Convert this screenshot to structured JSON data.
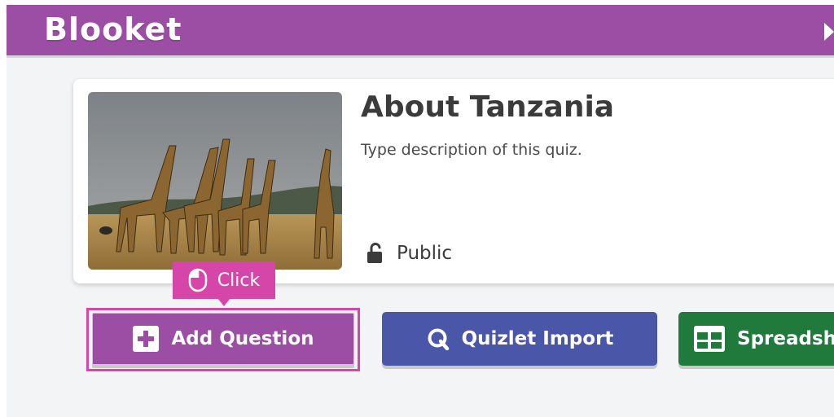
{
  "header": {
    "logo_text": "Blooket",
    "brand_color": "#9b4ea3"
  },
  "quiz": {
    "title": "About Tanzania",
    "description": "Type description of this quiz.",
    "visibility_label": "Public",
    "cover_image": "giraffes-on-savanna-photo"
  },
  "tooltip": {
    "label": "Click",
    "icon": "mouse-icon",
    "color": "#d645a8"
  },
  "actions": {
    "add_question": {
      "label": "Add Question",
      "icon": "plus-square-icon",
      "color": "#9b4ea3"
    },
    "quizlet_import": {
      "label": "Quizlet Import",
      "icon": "quizlet-q-icon",
      "color": "#4a56a8"
    },
    "spreadsheet": {
      "label": "Spreadsheet",
      "icon": "spreadsheet-grid-icon",
      "color": "#1f7a3c"
    }
  }
}
